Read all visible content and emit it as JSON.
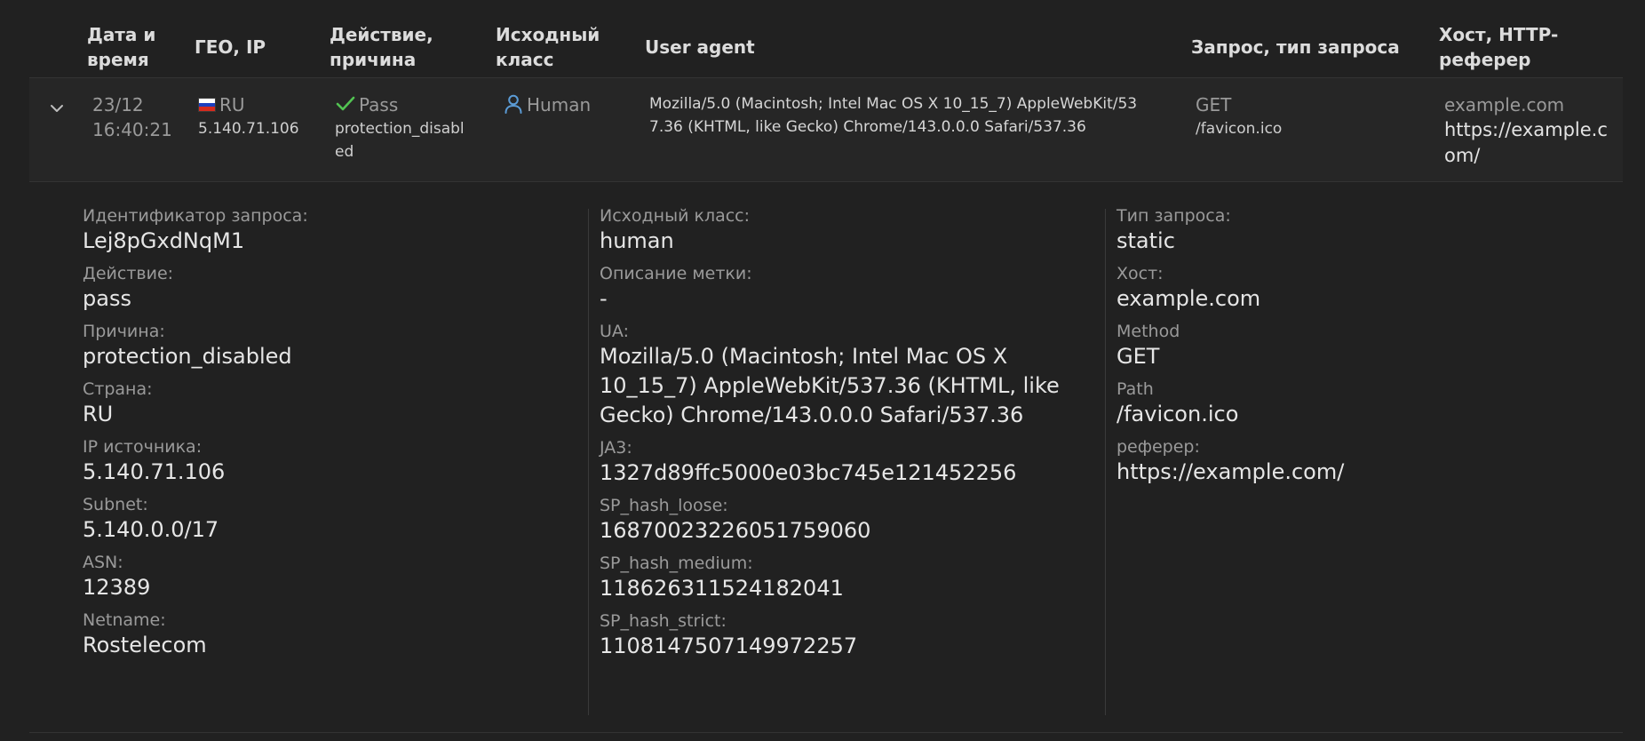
{
  "header": {
    "datetime": [
      "Дата и",
      "время"
    ],
    "geo_ip": "ГЕО, IP",
    "action": [
      "Действие,",
      "причина"
    ],
    "orig_class": [
      "Исходный",
      "класс"
    ],
    "user_agent": "User agent",
    "request": "Запрос, тип запроса",
    "host": [
      "Хост, HTTP-",
      "реферер"
    ]
  },
  "row": {
    "expand_icon": "chevron-down-icon",
    "date": "23/12",
    "time": "16:40:21",
    "country": "RU",
    "flag_colors": [
      "#ffffff",
      "#1c3fbf",
      "#d52b1e"
    ],
    "ip": "5.140.71.106",
    "action": "Pass",
    "action_icon": "check-icon",
    "action_color": "#52c352",
    "reason_lines": [
      "protection_disabl",
      "ed"
    ],
    "class_icon": "user-icon",
    "class_icon_color": "#5b9bd5",
    "class": "Human",
    "ua_lines": [
      "Mozilla/5.0 (Macintosh; Intel Mac OS X 10_15_7) AppleWebKit/53",
      "7.36 (KHTML, like Gecko) Chrome/143.0.0.0 Safari/537.36"
    ],
    "method": "GET",
    "path": "/favicon.ico",
    "host": "example.com",
    "referer_lines": [
      "https://example.c",
      "om/"
    ]
  },
  "details": {
    "col1": {
      "request_id_label": "Идентификатор запроса:",
      "request_id": "Lej8pGxdNqM1",
      "action_label": "Действие:",
      "action": "pass",
      "reason_label": "Причина:",
      "reason": "protection_disabled",
      "country_label": "Страна:",
      "country": "RU",
      "ip_label": "IP источника:",
      "ip": "5.140.71.106",
      "subnet_label": "Subnet:",
      "subnet": "5.140.0.0/17",
      "asn_label": "ASN:",
      "asn": "12389",
      "netname_label": "Netname:",
      "netname": "Rostelecom"
    },
    "col2": {
      "class_label": "Исходный класс:",
      "class": "human",
      "tag_desc_label": "Описание метки:",
      "tag_desc": "-",
      "ua_label": "UA:",
      "ua_lines": [
        "Mozilla/5.0 (Macintosh; Intel Mac OS X",
        "10_15_7) AppleWebKit/537.36 (KHTML, like",
        "Gecko) Chrome/143.0.0.0 Safari/537.36"
      ],
      "ja3_label": "JA3:",
      "ja3": "1327d89ffc5000e03bc745e121452256",
      "hash_loose_label": "SP_hash_loose:",
      "hash_loose": "16870023226051759060",
      "hash_medium_label": "SP_hash_medium:",
      "hash_medium": "118626311524182041",
      "hash_strict_label": "SP_hash_strict:",
      "hash_strict": "1108147507149972257"
    },
    "col3": {
      "req_type_label": "Тип запроса:",
      "req_type": "static",
      "host_label": "Хост:",
      "host": "example.com",
      "method_label": "Method",
      "method": "GET",
      "path_label": "Path",
      "path": "/favicon.ico",
      "referer_label": "реферер:",
      "referer": "https://example.com/"
    }
  },
  "colors": {
    "background": "#212121",
    "row_background": "#262626",
    "divider": "#333333"
  }
}
